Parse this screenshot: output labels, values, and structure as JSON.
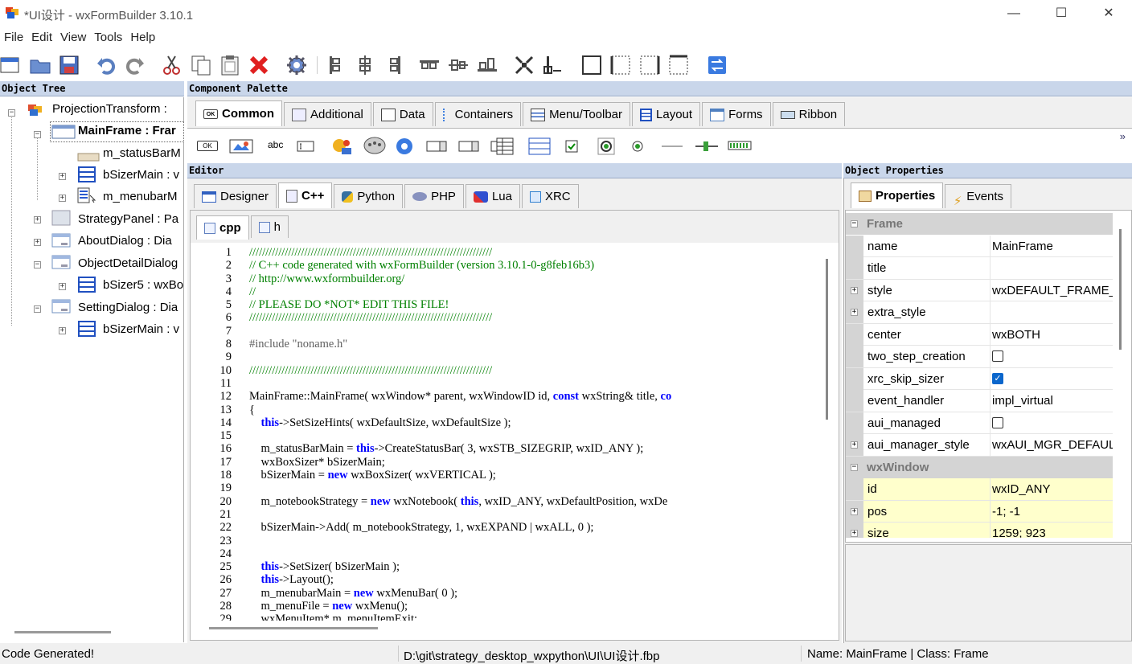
{
  "window": {
    "title": "*UI设计 - wxFormBuilder 3.10.1",
    "minimize": "—",
    "maximize": "☐",
    "close": "✕"
  },
  "menu": [
    "File",
    "Edit",
    "View",
    "Tools",
    "Help"
  ],
  "object_tree": {
    "caption": "Object Tree",
    "items": [
      {
        "label": "ProjectionTransform :",
        "icon": "project-icon",
        "expander": "−"
      },
      {
        "label": "MainFrame : Frar",
        "icon": "frame-icon",
        "expander": "−",
        "bold": true
      },
      {
        "label": "m_statusBarM",
        "icon": "statusbar-icon"
      },
      {
        "label": "bSizerMain : v",
        "icon": "sizer-icon",
        "expander": "+"
      },
      {
        "label": "m_menubarM",
        "icon": "menubar-icon",
        "expander": "+"
      },
      {
        "label": "StrategyPanel : Pa",
        "icon": "panel-icon",
        "expander": "+"
      },
      {
        "label": "AboutDialog : Dia",
        "icon": "dialog-icon",
        "expander": "+"
      },
      {
        "label": "ObjectDetailDialog",
        "icon": "dialog-icon",
        "expander": "−"
      },
      {
        "label": "bSizer5 : wxBo",
        "icon": "sizer-icon",
        "expander": "+"
      },
      {
        "label": "SettingDialog : Dia",
        "icon": "dialog-icon",
        "expander": "−"
      },
      {
        "label": "bSizerMain : v",
        "icon": "sizer-icon",
        "expander": "+"
      }
    ]
  },
  "palette": {
    "caption": "Component Palette",
    "tabs": [
      "Common",
      "Additional",
      "Data",
      "Containers",
      "Menu/Toolbar",
      "Layout",
      "Forms",
      "Ribbon"
    ],
    "active_tab": "Common",
    "more": "»",
    "button_icon_text": "OK",
    "static_text_icon": "abc"
  },
  "editor": {
    "caption": "Editor",
    "tabs": [
      "Designer",
      "C++",
      "Python",
      "PHP",
      "Lua",
      "XRC"
    ],
    "active_tab": "C++",
    "file_tabs": [
      "cpp",
      "h"
    ],
    "active_file_tab": "cpp",
    "lines": [
      {
        "n": "1",
        "html": "<span class=\"cmt\">///////////////////////////////////////////////////////////////////////////</span>"
      },
      {
        "n": "2",
        "html": "<span class=\"cmt\">// C++ code generated with wxFormBuilder (version 3.10.1-0-g8feb16b3)</span>"
      },
      {
        "n": "3",
        "html": "<span class=\"cmt\">// http://www.wxformbuilder.org/</span>"
      },
      {
        "n": "4",
        "html": "<span class=\"cmt\">//</span>"
      },
      {
        "n": "5",
        "html": "<span class=\"cmt\">// PLEASE DO *NOT* EDIT THIS FILE!</span>"
      },
      {
        "n": "6",
        "html": "<span class=\"cmt\">///////////////////////////////////////////////////////////////////////////</span>"
      },
      {
        "n": "7",
        "html": ""
      },
      {
        "n": "8",
        "html": "<span class=\"pp\">#include \"noname.h\"</span>"
      },
      {
        "n": "9",
        "html": ""
      },
      {
        "n": "10",
        "html": "<span class=\"cmt\">///////////////////////////////////////////////////////////////////////////</span>"
      },
      {
        "n": "11",
        "html": ""
      },
      {
        "n": "12",
        "html": "MainFrame::MainFrame( wxWindow* parent, wxWindowID id, <span class=\"kw\">const</span> wxString&amp; title, <span class=\"kw\">co</span>"
      },
      {
        "n": "13",
        "html": "{"
      },
      {
        "n": "14",
        "html": "    <span class=\"kw\">this</span>-&gt;SetSizeHints( wxDefaultSize, wxDefaultSize );"
      },
      {
        "n": "15",
        "html": ""
      },
      {
        "n": "16",
        "html": "    m_statusBarMain = <span class=\"kw\">this</span>-&gt;CreateStatusBar( 3, wxSTB_SIZEGRIP, wxID_ANY );"
      },
      {
        "n": "17",
        "html": "    wxBoxSizer* bSizerMain;"
      },
      {
        "n": "18",
        "html": "    bSizerMain = <span class=\"kw\">new</span> wxBoxSizer( wxVERTICAL );"
      },
      {
        "n": "19",
        "html": ""
      },
      {
        "n": "20",
        "html": "    m_notebookStrategy = <span class=\"kw\">new</span> wxNotebook( <span class=\"kw\">this</span>, wxID_ANY, wxDefaultPosition, wxDe"
      },
      {
        "n": "21",
        "html": ""
      },
      {
        "n": "22",
        "html": "    bSizerMain-&gt;Add( m_notebookStrategy, 1, wxEXPAND | wxALL, 0 );"
      },
      {
        "n": "23",
        "html": ""
      },
      {
        "n": "24",
        "html": ""
      },
      {
        "n": "25",
        "html": "    <span class=\"kw\">this</span>-&gt;SetSizer( bSizerMain );"
      },
      {
        "n": "26",
        "html": "    <span class=\"kw\">this</span>-&gt;Layout();"
      },
      {
        "n": "27",
        "html": "    m_menubarMain = <span class=\"kw\">new</span> wxMenuBar( 0 );"
      },
      {
        "n": "28",
        "html": "    m_menuFile = <span class=\"kw\">new</span> wxMenu();"
      },
      {
        "n": "29",
        "html": "    wxMenuItem* m_menuItemExit;"
      }
    ]
  },
  "properties": {
    "caption": "Object Properties",
    "tabs": [
      "Properties",
      "Events"
    ],
    "active_tab": "Properties",
    "rows": [
      {
        "type": "cat",
        "label": "Frame",
        "exp": "−"
      },
      {
        "name": "name",
        "value": "MainFrame"
      },
      {
        "name": "title",
        "value": ""
      },
      {
        "name": "style",
        "value": "wxDEFAULT_FRAME_",
        "exp": "+"
      },
      {
        "name": "extra_style",
        "value": "",
        "exp": "+"
      },
      {
        "name": "center",
        "value": "wxBOTH"
      },
      {
        "name": "two_step_creation",
        "check": false
      },
      {
        "name": "xrc_skip_sizer",
        "check": true
      },
      {
        "name": "event_handler",
        "value": "impl_virtual"
      },
      {
        "name": "aui_managed",
        "check": false
      },
      {
        "name": "aui_manager_style",
        "value": "wxAUI_MGR_DEFAUL",
        "exp": "+"
      },
      {
        "type": "cat",
        "label": "wxWindow",
        "exp": "−"
      },
      {
        "name": "id",
        "value": "wxID_ANY",
        "highlight": true
      },
      {
        "name": "pos",
        "value": "-1; -1",
        "exp": "+",
        "highlight": true
      },
      {
        "name": "size",
        "value": "1259; 923",
        "exp": "+",
        "highlight": true
      }
    ]
  },
  "status": {
    "left": "Code Generated!",
    "middle": "D:\\git\\strategy_desktop_wxpython\\UI\\UI设计.fbp",
    "right": "Name: MainFrame | Class: Frame"
  }
}
